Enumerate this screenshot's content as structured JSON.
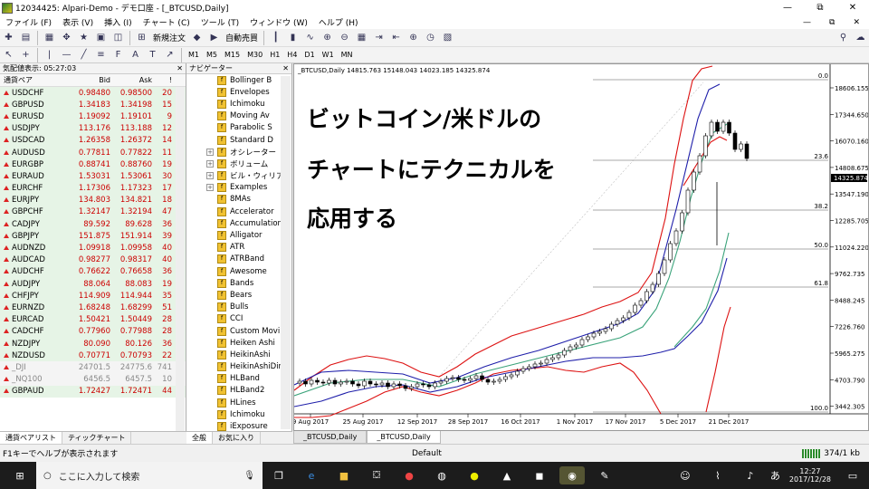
{
  "window": {
    "title": "12034425: Alpari-Demo - デモ口座 - [_BTCUSD,Daily]",
    "min": "—",
    "max": "⧉",
    "close": "✕"
  },
  "menu": [
    "ファイル (F)",
    "表示 (V)",
    "挿入 (I)",
    "チャート (C)",
    "ツール (T)",
    "ウィンドウ (W)",
    "ヘルプ (H)"
  ],
  "toolbar": {
    "new_order": "新規注文",
    "auto_trade": "自動売買"
  },
  "timeframes": [
    "M1",
    "M5",
    "M15",
    "M30",
    "H1",
    "H4",
    "D1",
    "W1",
    "MN"
  ],
  "market_watch": {
    "header": "気配値表示: 05:27:03",
    "columns": [
      "通貨ペア",
      "Bid",
      "Ask",
      "!"
    ],
    "rows": [
      [
        "USDCHF",
        "0.98480",
        "0.98500",
        "20"
      ],
      [
        "GBPUSD",
        "1.34183",
        "1.34198",
        "15"
      ],
      [
        "EURUSD",
        "1.19092",
        "1.19101",
        "9"
      ],
      [
        "USDJPY",
        "113.176",
        "113.188",
        "12"
      ],
      [
        "USDCAD",
        "1.26358",
        "1.26372",
        "14"
      ],
      [
        "AUDUSD",
        "0.77811",
        "0.77822",
        "11"
      ],
      [
        "EURGBP",
        "0.88741",
        "0.88760",
        "19"
      ],
      [
        "EURAUD",
        "1.53031",
        "1.53061",
        "30"
      ],
      [
        "EURCHF",
        "1.17306",
        "1.17323",
        "17"
      ],
      [
        "EURJPY",
        "134.803",
        "134.821",
        "18"
      ],
      [
        "GBPCHF",
        "1.32147",
        "1.32194",
        "47"
      ],
      [
        "CADJPY",
        "89.592",
        "89.628",
        "36"
      ],
      [
        "GBPJPY",
        "151.875",
        "151.914",
        "39"
      ],
      [
        "AUDNZD",
        "1.09918",
        "1.09958",
        "40"
      ],
      [
        "AUDCAD",
        "0.98277",
        "0.98317",
        "40"
      ],
      [
        "AUDCHF",
        "0.76622",
        "0.76658",
        "36"
      ],
      [
        "AUDJPY",
        "88.064",
        "88.083",
        "19"
      ],
      [
        "CHFJPY",
        "114.909",
        "114.944",
        "35"
      ],
      [
        "EURNZD",
        "1.68248",
        "1.68299",
        "51"
      ],
      [
        "EURCAD",
        "1.50421",
        "1.50449",
        "28"
      ],
      [
        "CADCHF",
        "0.77960",
        "0.77988",
        "28"
      ],
      [
        "NZDJPY",
        "80.090",
        "80.126",
        "36"
      ],
      [
        "NZDUSD",
        "0.70771",
        "0.70793",
        "22"
      ],
      [
        "_DJI",
        "24701.5",
        "24775.6",
        "741"
      ],
      [
        "_NQ100",
        "6456.5",
        "6457.5",
        "10"
      ],
      [
        "GBPAUD",
        "1.72427",
        "1.72471",
        "44"
      ]
    ],
    "tabs": [
      "通貨ペアリスト",
      "ティックチャート"
    ]
  },
  "navigator": {
    "header": "ナビゲーター",
    "items": [
      {
        "t": "Bollinger B",
        "k": "ind"
      },
      {
        "t": "Envelopes",
        "k": "ind"
      },
      {
        "t": "Ichimoku",
        "k": "ind"
      },
      {
        "t": "Moving Av",
        "k": "ind"
      },
      {
        "t": "Parabolic S",
        "k": "ind"
      },
      {
        "t": "Standard D",
        "k": "ind"
      },
      {
        "t": "オシレーター",
        "k": "grp"
      },
      {
        "t": "ボリューム",
        "k": "grp"
      },
      {
        "t": "ビル・ウィリアムズ",
        "k": "grp"
      },
      {
        "t": "Examples",
        "k": "grp"
      },
      {
        "t": "8MAs",
        "k": "ind"
      },
      {
        "t": "Accelerator",
        "k": "ind"
      },
      {
        "t": "Accumulation",
        "k": "ind"
      },
      {
        "t": "Alligator",
        "k": "ind"
      },
      {
        "t": "ATR",
        "k": "ind"
      },
      {
        "t": "ATRBand",
        "k": "ind"
      },
      {
        "t": "Awesome",
        "k": "ind"
      },
      {
        "t": "Bands",
        "k": "ind"
      },
      {
        "t": "Bears",
        "k": "ind"
      },
      {
        "t": "Bulls",
        "k": "ind"
      },
      {
        "t": "CCI",
        "k": "ind"
      },
      {
        "t": "Custom Movin",
        "k": "ind"
      },
      {
        "t": "Heiken Ashi",
        "k": "ind"
      },
      {
        "t": "HeikinAshi",
        "k": "ind"
      },
      {
        "t": "HeikinAshiDir",
        "k": "ind"
      },
      {
        "t": "HLBand",
        "k": "ind"
      },
      {
        "t": "HLBand2",
        "k": "ind"
      },
      {
        "t": "HLines",
        "k": "ind"
      },
      {
        "t": "Ichimoku",
        "k": "ind"
      },
      {
        "t": "iExposure",
        "k": "ind"
      }
    ],
    "tabs": [
      "全般",
      "お気に入り"
    ]
  },
  "chart": {
    "info": "_BTCUSD,Daily  14815.763 15148.043 14023.185 14325.874",
    "overlay_lines": [
      "ビットコイン/米ドルの",
      "チャートにテクニカルを",
      "応用する"
    ],
    "price_labels": [
      "18606.155",
      "17344.650",
      "16070.160",
      "14808.675",
      "13547.190",
      "12285.705",
      "11024.220",
      "9762.735",
      "8488.245",
      "7226.760",
      "5965.275",
      "4703.790",
      "3442.305"
    ],
    "current_price": "14325.874",
    "fib_labels": [
      "0.0",
      "23.6",
      "38.2",
      "50.0",
      "61.8",
      "100.0"
    ],
    "date_labels": [
      "9 Aug 2017",
      "25 Aug 2017",
      "12 Sep 2017",
      "28 Sep 2017",
      "16 Oct 2017",
      "1 Nov 2017",
      "17 Nov 2017",
      "5 Dec 2017",
      "21 Dec 2017"
    ],
    "tabs": [
      "_BTCUSD,Daily",
      "_BTCUSD,Daily"
    ],
    "colors": {
      "outer_band": "#d11",
      "mid_band": "#1f1faa",
      "inner_band": "#3aa37a",
      "candle": "#000"
    }
  },
  "status": {
    "help": "F1キーでヘルプが表示されます",
    "profile": "Default",
    "traffic": "374/1 kb"
  },
  "taskbar": {
    "search": "ここに入力して検索",
    "time": "12:27",
    "date": "2017/12/28",
    "ime": "あ"
  }
}
